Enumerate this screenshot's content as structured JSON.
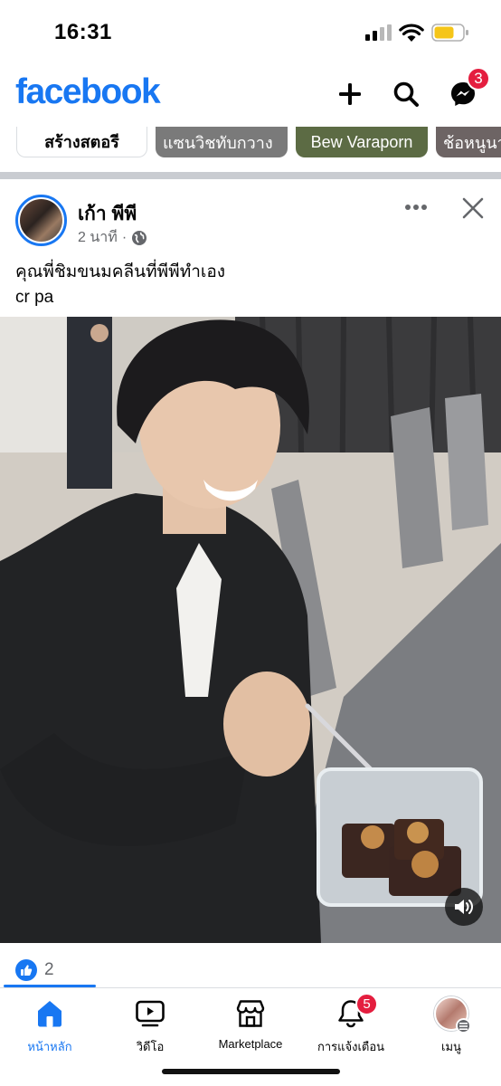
{
  "status_bar": {
    "time": "16:31",
    "icons": [
      "signal-icon",
      "wifi-icon",
      "battery-icon"
    ],
    "battery_color": "#f5c518"
  },
  "header": {
    "logo": "facebook",
    "logo_color": "#1877f2",
    "actions": [
      "plus-icon",
      "search-icon",
      "messenger-icon"
    ],
    "messenger_badge": "3"
  },
  "stories": {
    "create_label": "สร้างสตอรี",
    "items": [
      "แซนวิชทับกวาง",
      "Bew Varaporn",
      "ช้อหนูนา"
    ]
  },
  "post": {
    "author": "เก้า พีพี",
    "time": "2 นาที",
    "separator": "·",
    "privacy_icon": "globe-icon",
    "caption_line1": "คุณพี่ชิมขนมคลีนที่พีพีทำเอง",
    "caption_line2": "cr pa",
    "reaction_count": "2",
    "reaction_icon": "like-icon"
  },
  "tabs": [
    {
      "label": "หน้าหลัก",
      "icon": "home-icon",
      "active": true
    },
    {
      "label": "วิดีโอ",
      "icon": "video-icon",
      "active": false
    },
    {
      "label": "Marketplace",
      "icon": "marketplace-icon",
      "active": false
    },
    {
      "label": "การแจ้งเตือน",
      "icon": "bell-icon",
      "active": false,
      "badge": "5"
    },
    {
      "label": "เมนู",
      "icon": "profile-menu-icon",
      "active": false
    }
  ],
  "colors": {
    "accent": "#1877f2",
    "badge": "#e41e3f",
    "secondary_text": "#65676b"
  }
}
